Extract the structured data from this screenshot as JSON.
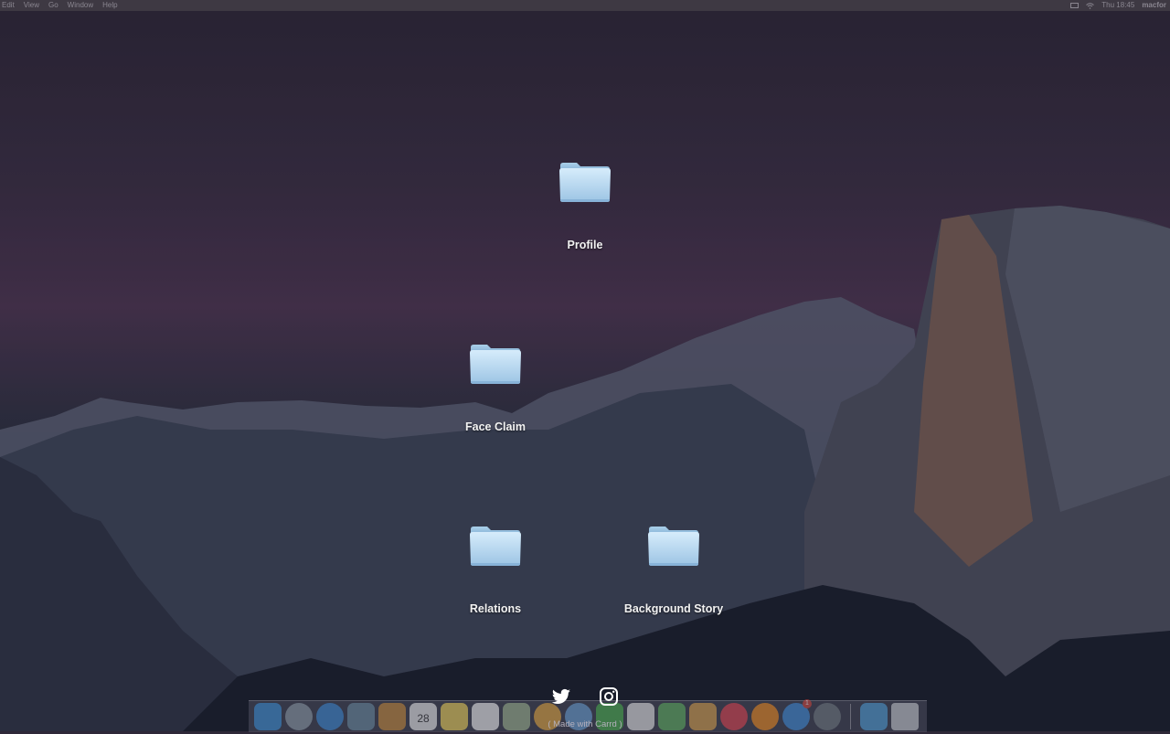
{
  "menubar": {
    "items": [
      "Edit",
      "View",
      "Go",
      "Window",
      "Help"
    ],
    "clock": "Thu 18:45",
    "user": "macfor"
  },
  "desktop": {
    "folders": [
      {
        "label": "Profile"
      },
      {
        "label": "Face Claim"
      },
      {
        "label": "Relations"
      },
      {
        "label": "Background Story"
      }
    ]
  },
  "social": {
    "icons": [
      "twitter-icon",
      "instagram-icon"
    ],
    "credit": "( Made with Carrd )"
  },
  "dock": {
    "calendar_day": "28",
    "app_store_badge": "1"
  },
  "colors": {
    "folder_light": "#cfe6f6",
    "folder_dark": "#8fb9dc",
    "label": "#f2f2f2"
  }
}
